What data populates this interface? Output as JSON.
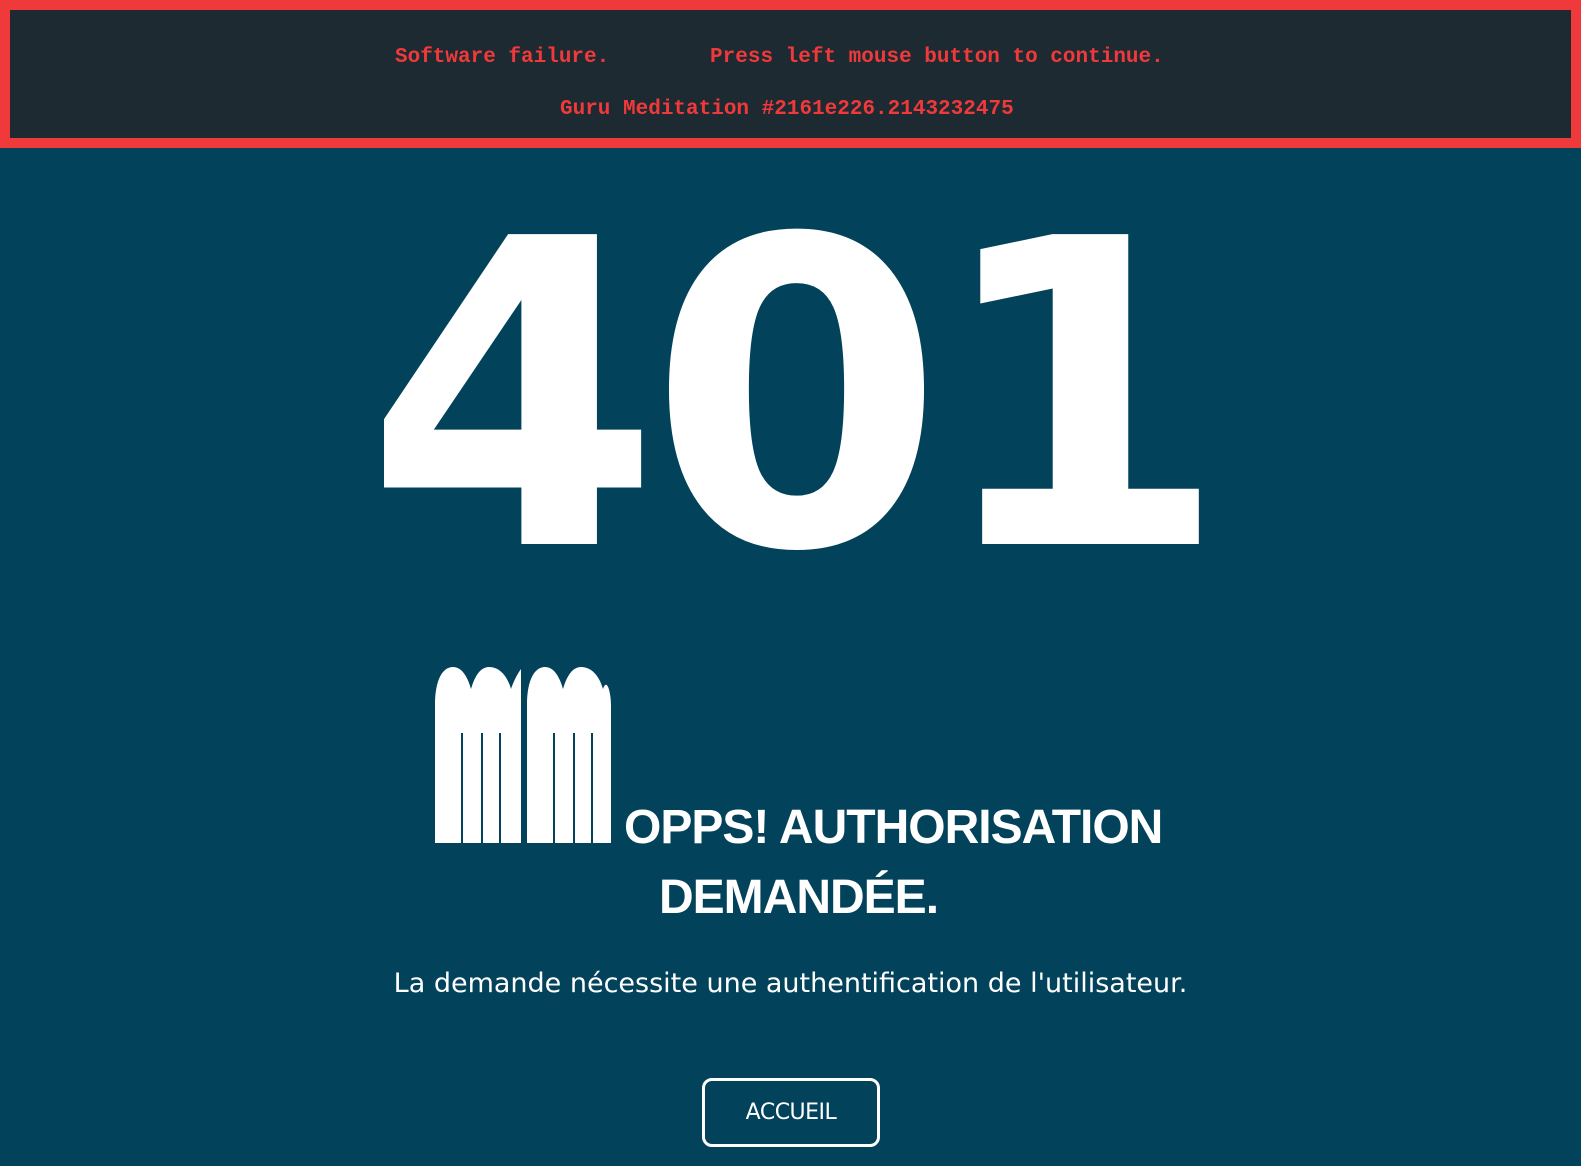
{
  "guru": {
    "line1": "Software failure.        Press left mouse button to continue.",
    "line2": "Guru Meditation #2161e226.2143232475"
  },
  "error": {
    "code": "401",
    "headline_line1": "OPPS! AUTHORISATION",
    "headline_line2": "DEMANDÉE.",
    "description": "La demande nécessite une authentification de l'utilisateur."
  },
  "actions": {
    "home_label": "ACCUEIL"
  },
  "logo": {
    "icon": "mm-logo-icon"
  },
  "colors": {
    "background": "#02435b",
    "guru_text": "#f0393a",
    "guru_border": "#f0393a",
    "guru_background": "#1e2a31",
    "text": "#ffffff"
  }
}
